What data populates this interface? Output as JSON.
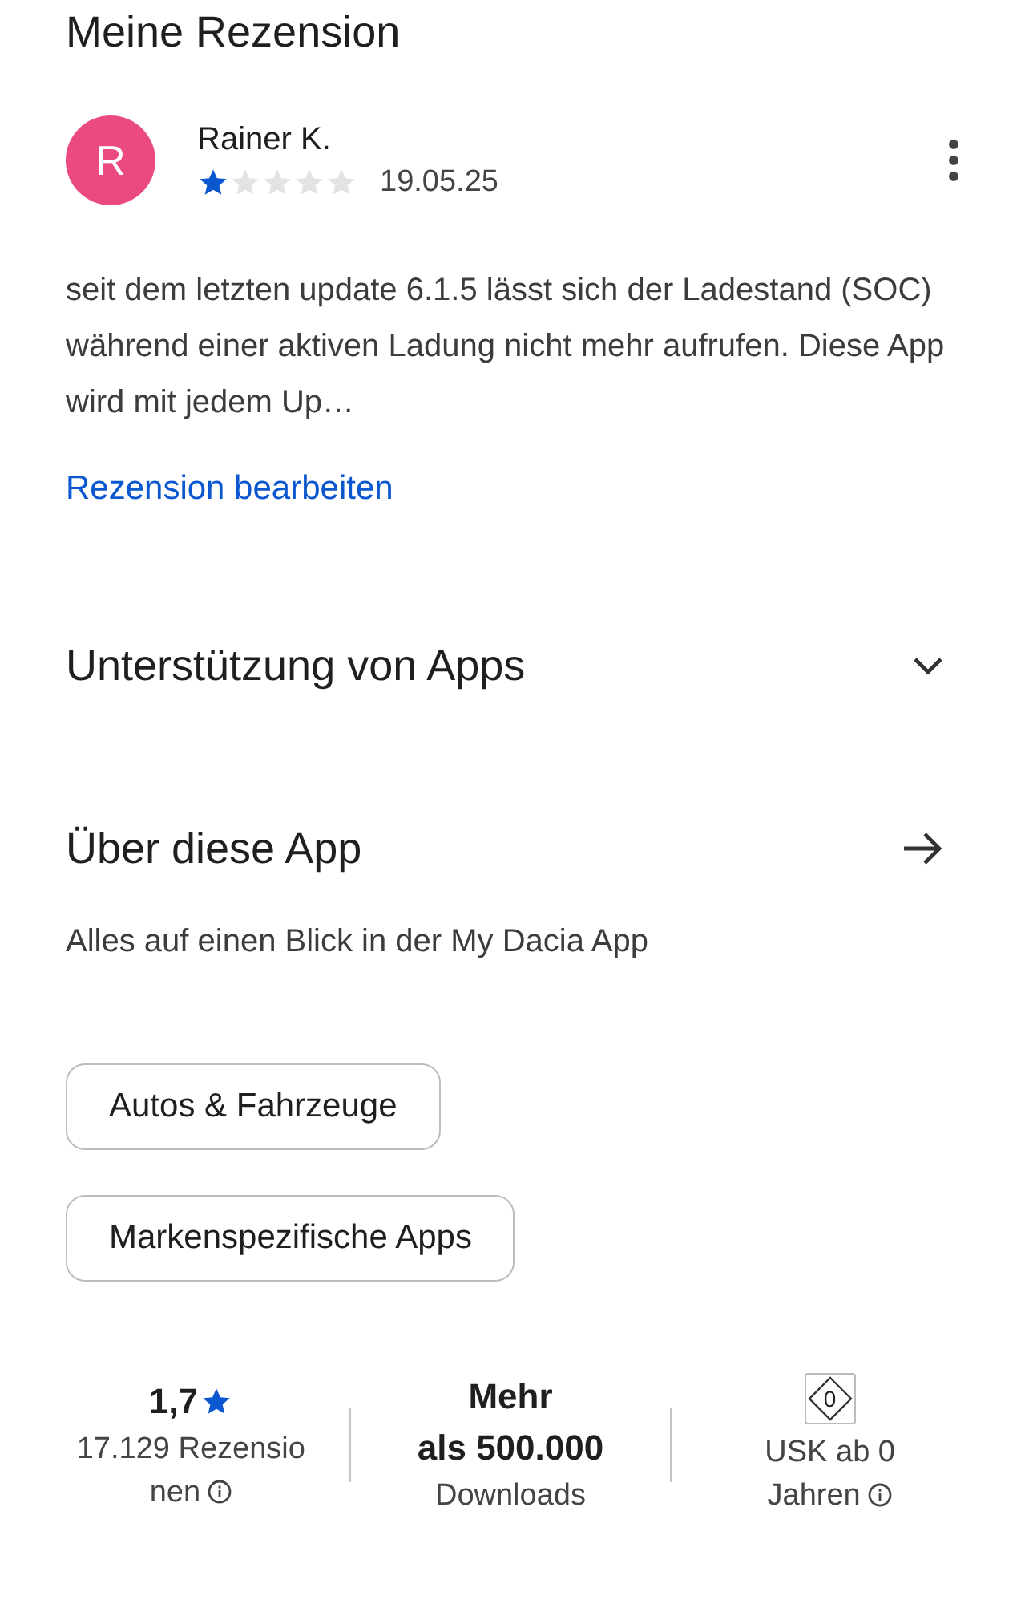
{
  "review_section": {
    "title": "Meine Rezension",
    "review": {
      "avatar_letter": "R",
      "author": "Rainer K.",
      "stars": 1,
      "date": "19.05.25",
      "text": "seit dem letzten update 6.1.5 lässt sich der Ladestand (SOC) während einer aktiven Ladung nicht mehr aufrufen. Diese App wird mit jedem Up…"
    },
    "edit_link": "Rezension bearbeiten"
  },
  "sections": [
    {
      "kind": "expand",
      "title": "Unterstützung von Apps"
    },
    {
      "kind": "link",
      "title": "Über diese App",
      "description": "Alles auf einen Blick in der My Dacia App"
    }
  ],
  "chips": [
    "Autos & Fahrzeuge",
    "Markenspezifische Apps"
  ],
  "stats": [
    {
      "kind": "rating",
      "value": "1,7",
      "lines": [
        "17.129 Rezensio",
        "nen"
      ],
      "info": true
    },
    {
      "kind": "text",
      "value_lines": [
        "Mehr",
        "als 500.000"
      ],
      "lines": [
        "Downloads"
      ],
      "info": false
    },
    {
      "kind": "badge",
      "badge": "0",
      "lines": [
        "USK ab 0",
        "Jahren"
      ],
      "info": true
    }
  ]
}
